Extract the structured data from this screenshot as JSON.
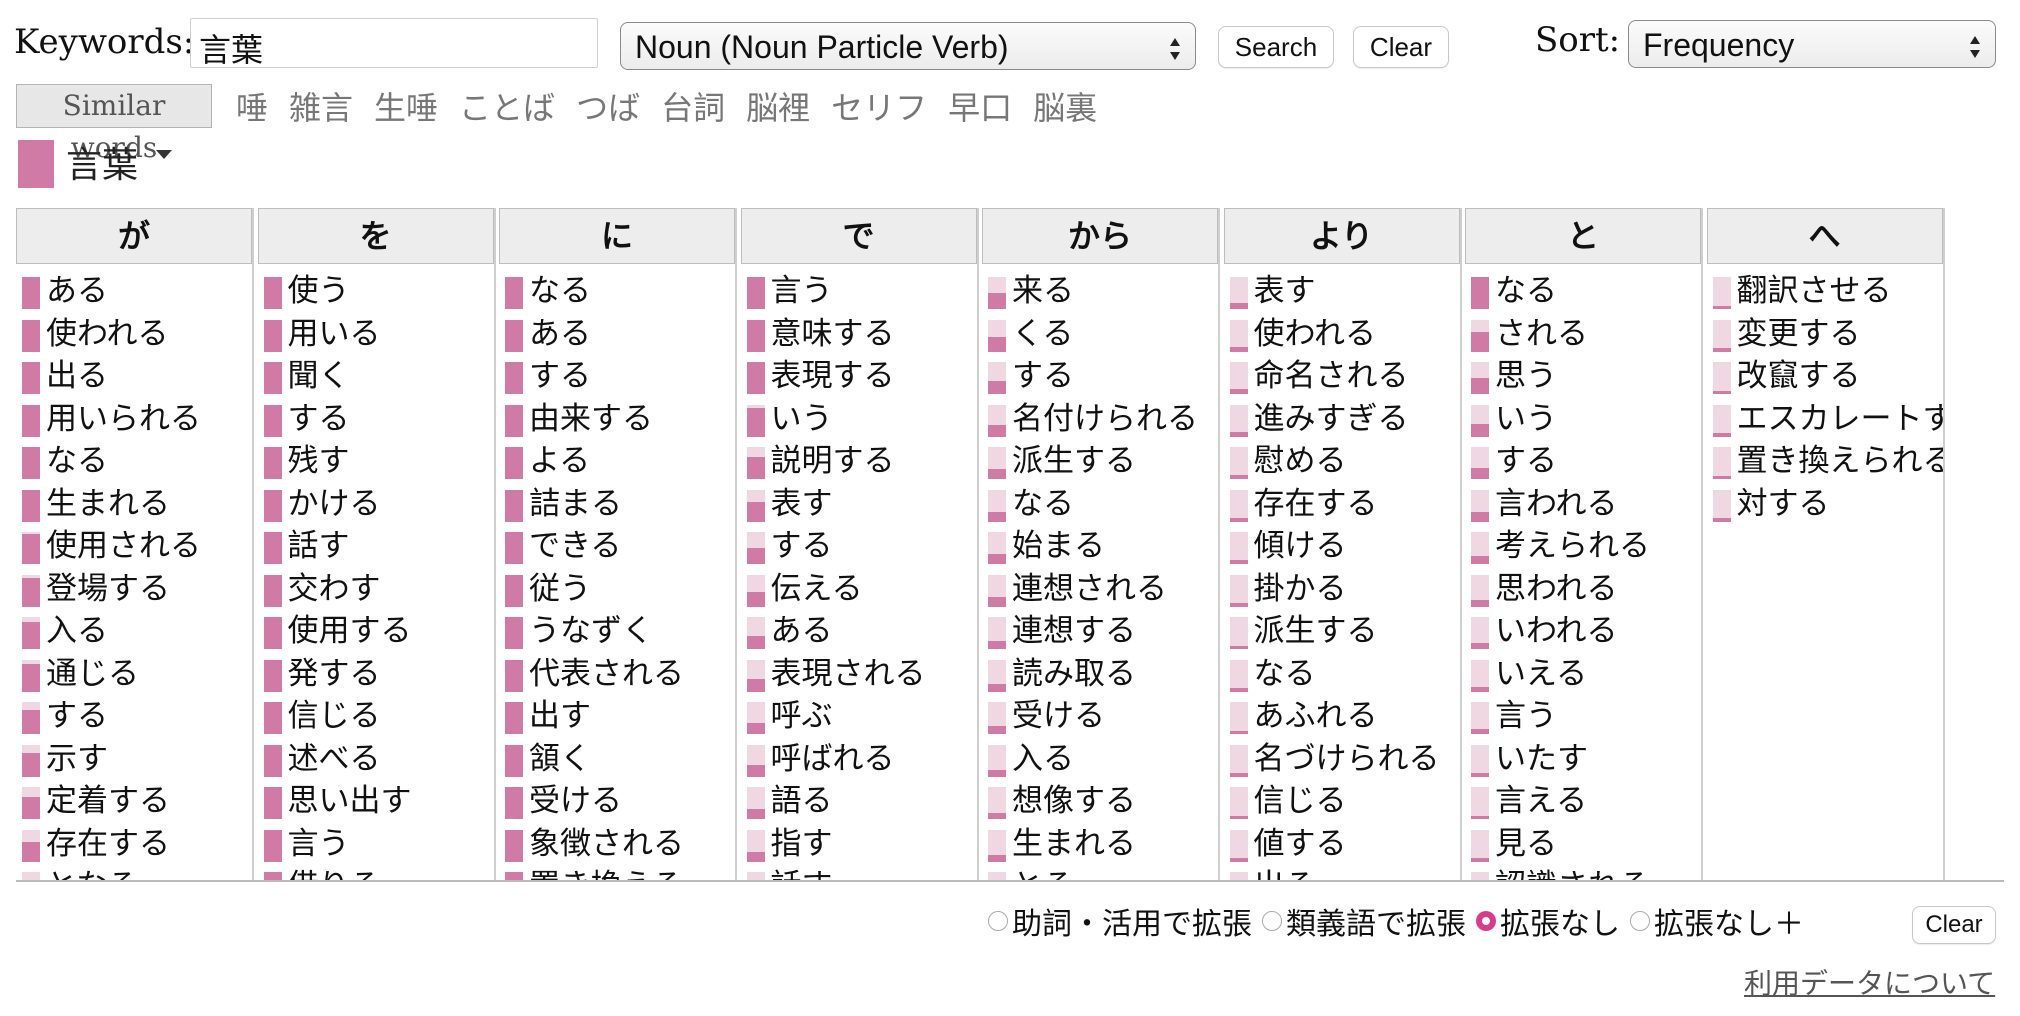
{
  "search": {
    "keywords_label": "Keywords:",
    "keywords_value": "言葉",
    "mode_select": "Noun (Noun Particle Verb)",
    "search_label": "Search",
    "clear_label": "Clear",
    "sort_label": "Sort:",
    "sort_select": "Frequency"
  },
  "similar": {
    "button_label": "Similar words",
    "words": [
      "唾",
      "雑言",
      "生唾",
      "ことば",
      "つば",
      "台詞",
      "脳裡",
      "セリフ",
      "早口",
      "脳裏"
    ]
  },
  "current_word": {
    "label": "言葉",
    "color": "#d07ba6"
  },
  "colors": {
    "accent": "#d07ba6",
    "bar_bg": "#f0d8e3",
    "radio_on": "#d83d8c"
  },
  "columns": [
    {
      "particle": "が",
      "items": [
        {
          "verb": "ある",
          "score": 1.0
        },
        {
          "verb": "使われる",
          "score": 1.0
        },
        {
          "verb": "出る",
          "score": 1.0
        },
        {
          "verb": "用いられる",
          "score": 1.0
        },
        {
          "verb": "なる",
          "score": 1.0
        },
        {
          "verb": "生まれる",
          "score": 1.0
        },
        {
          "verb": "使用される",
          "score": 0.95
        },
        {
          "verb": "登場する",
          "score": 0.9
        },
        {
          "verb": "入る",
          "score": 0.85
        },
        {
          "verb": "通じる",
          "score": 0.85
        },
        {
          "verb": "する",
          "score": 0.75
        },
        {
          "verb": "示す",
          "score": 0.75
        },
        {
          "verb": "定着する",
          "score": 0.7
        },
        {
          "verb": "存在する",
          "score": 0.6
        },
        {
          "verb": "となる",
          "score": 0.5
        }
      ]
    },
    {
      "particle": "を",
      "items": [
        {
          "verb": "使う",
          "score": 1.0
        },
        {
          "verb": "用いる",
          "score": 1.0
        },
        {
          "verb": "聞く",
          "score": 1.0
        },
        {
          "verb": "する",
          "score": 1.0
        },
        {
          "verb": "残す",
          "score": 1.0
        },
        {
          "verb": "かける",
          "score": 1.0
        },
        {
          "verb": "話す",
          "score": 1.0
        },
        {
          "verb": "交わす",
          "score": 1.0
        },
        {
          "verb": "使用する",
          "score": 1.0
        },
        {
          "verb": "発する",
          "score": 1.0
        },
        {
          "verb": "信じる",
          "score": 1.0
        },
        {
          "verb": "述べる",
          "score": 1.0
        },
        {
          "verb": "思い出す",
          "score": 1.0
        },
        {
          "verb": "言う",
          "score": 1.0
        },
        {
          "verb": "借りる",
          "score": 1.0
        }
      ]
    },
    {
      "particle": "に",
      "items": [
        {
          "verb": "なる",
          "score": 1.0
        },
        {
          "verb": "ある",
          "score": 1.0
        },
        {
          "verb": "する",
          "score": 1.0
        },
        {
          "verb": "由来する",
          "score": 1.0
        },
        {
          "verb": "よる",
          "score": 1.0
        },
        {
          "verb": "詰まる",
          "score": 1.0
        },
        {
          "verb": "できる",
          "score": 1.0
        },
        {
          "verb": "従う",
          "score": 1.0
        },
        {
          "verb": "うなずく",
          "score": 1.0
        },
        {
          "verb": "代表される",
          "score": 1.0
        },
        {
          "verb": "出す",
          "score": 1.0
        },
        {
          "verb": "頷く",
          "score": 1.0
        },
        {
          "verb": "受ける",
          "score": 1.0
        },
        {
          "verb": "象徴される",
          "score": 1.0
        },
        {
          "verb": "置き換える",
          "score": 1.0
        }
      ]
    },
    {
      "particle": "で",
      "items": [
        {
          "verb": "言う",
          "score": 1.0
        },
        {
          "verb": "意味する",
          "score": 1.0
        },
        {
          "verb": "表現する",
          "score": 1.0
        },
        {
          "verb": "いう",
          "score": 0.9
        },
        {
          "verb": "説明する",
          "score": 0.7
        },
        {
          "verb": "表す",
          "score": 0.6
        },
        {
          "verb": "する",
          "score": 0.5
        },
        {
          "verb": "伝える",
          "score": 0.45
        },
        {
          "verb": "ある",
          "score": 0.4
        },
        {
          "verb": "表現される",
          "score": 0.4
        },
        {
          "verb": "呼ぶ",
          "score": 0.35
        },
        {
          "verb": "呼ばれる",
          "score": 0.35
        },
        {
          "verb": "語る",
          "score": 0.3
        },
        {
          "verb": "指す",
          "score": 0.3
        },
        {
          "verb": "話す",
          "score": 0.3
        }
      ]
    },
    {
      "particle": "から",
      "items": [
        {
          "verb": "来る",
          "score": 0.5
        },
        {
          "verb": "くる",
          "score": 0.45
        },
        {
          "verb": "する",
          "score": 0.4
        },
        {
          "verb": "名付けられる",
          "score": 0.35
        },
        {
          "verb": "派生する",
          "score": 0.3
        },
        {
          "verb": "なる",
          "score": 0.3
        },
        {
          "verb": "始まる",
          "score": 0.3
        },
        {
          "verb": "連想される",
          "score": 0.3
        },
        {
          "verb": "連想する",
          "score": 0.25
        },
        {
          "verb": "読み取る",
          "score": 0.25
        },
        {
          "verb": "受ける",
          "score": 0.25
        },
        {
          "verb": "入る",
          "score": 0.2
        },
        {
          "verb": "想像する",
          "score": 0.2
        },
        {
          "verb": "生まれる",
          "score": 0.2
        },
        {
          "verb": "とる",
          "score": 0.2
        }
      ]
    },
    {
      "particle": "より",
      "items": [
        {
          "verb": "表す",
          "score": 0.2
        },
        {
          "verb": "使われる",
          "score": 0.15
        },
        {
          "verb": "命名される",
          "score": 0.15
        },
        {
          "verb": "進みすぎる",
          "score": 0.15
        },
        {
          "verb": "慰める",
          "score": 0.12
        },
        {
          "verb": "存在する",
          "score": 0.12
        },
        {
          "verb": "傾ける",
          "score": 0.12
        },
        {
          "verb": "掛かる",
          "score": 0.1
        },
        {
          "verb": "派生する",
          "score": 0.1
        },
        {
          "verb": "なる",
          "score": 0.1
        },
        {
          "verb": "あふれる",
          "score": 0.1
        },
        {
          "verb": "名づけられる",
          "score": 0.1
        },
        {
          "verb": "信じる",
          "score": 0.1
        },
        {
          "verb": "値する",
          "score": 0.1
        },
        {
          "verb": "出る",
          "score": 0.1
        }
      ]
    },
    {
      "particle": "と",
      "items": [
        {
          "verb": "なる",
          "score": 1.0
        },
        {
          "verb": "される",
          "score": 0.6
        },
        {
          "verb": "思う",
          "score": 0.5
        },
        {
          "verb": "いう",
          "score": 0.4
        },
        {
          "verb": "する",
          "score": 0.35
        },
        {
          "verb": "言われる",
          "score": 0.3
        },
        {
          "verb": "考えられる",
          "score": 0.25
        },
        {
          "verb": "思われる",
          "score": 0.2
        },
        {
          "verb": "いわれる",
          "score": 0.2
        },
        {
          "verb": "いえる",
          "score": 0.15
        },
        {
          "verb": "言う",
          "score": 0.15
        },
        {
          "verb": "いたす",
          "score": 0.1
        },
        {
          "verb": "言える",
          "score": 0.1
        },
        {
          "verb": "見る",
          "score": 0.1
        },
        {
          "verb": "認識される",
          "score": 0.1
        }
      ]
    },
    {
      "particle": "へ",
      "items": [
        {
          "verb": "翻訳させる",
          "score": 0.1
        },
        {
          "verb": "変更する",
          "score": 0.1
        },
        {
          "verb": "改竄する",
          "score": 0.1
        },
        {
          "verb": "エスカレートする",
          "score": 0.1
        },
        {
          "verb": "置き換えられる",
          "score": 0.1
        },
        {
          "verb": "対する",
          "score": 0.1
        }
      ]
    }
  ],
  "options": {
    "radios": [
      {
        "label": "助詞・活用で拡張",
        "checked": false
      },
      {
        "label": "類義語で拡張",
        "checked": false
      },
      {
        "label": "拡張なし",
        "checked": true
      },
      {
        "label": "拡張なし＋",
        "checked": false
      }
    ],
    "clear_label": "Clear"
  },
  "footer": {
    "link_label": "利用データについて"
  }
}
